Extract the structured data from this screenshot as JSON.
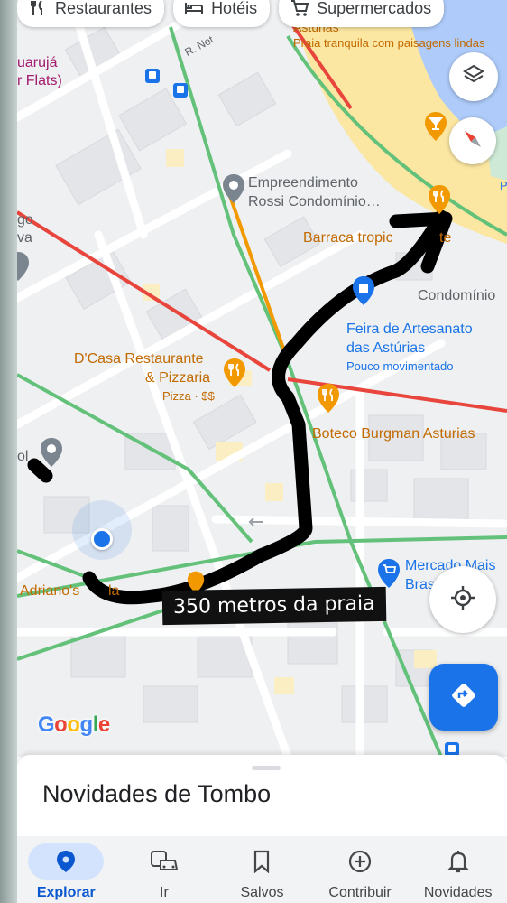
{
  "chips": [
    {
      "label": "Restaurantes",
      "icon": "fork-knife-icon"
    },
    {
      "label": "Hotéis",
      "icon": "bed-icon"
    },
    {
      "label": "Supermercados",
      "icon": "cart-icon"
    }
  ],
  "map": {
    "labels": {
      "road_r_net": "R. Net",
      "guaruja_1": "uarujá",
      "guaruja_2": "r Flats)",
      "asturias_cut": "Astúrias",
      "praia_tranquila": "Praia tranquila com paisagens lindas",
      "empreendimento_1": "Empreendimento",
      "empreendimento_2": "Rossi Condomínio…",
      "go_1": "go",
      "go_2": "va",
      "barraca": "Barraca tropic",
      "barraca_tail": "te",
      "condominio": "Condomínio",
      "feira_1": "Feira de Artesanato",
      "feira_2": "das Astúrias",
      "feira_status": "Pouco movimentado",
      "dcasa_1": "D'Casa Restaurante",
      "dcasa_2": "& Pizzaria",
      "dcasa_sub": "Pizza · $$",
      "boteco": "Boteco Burgman Asturias",
      "ol": "ol",
      "mercado_1": "Mercado Mais",
      "mercado_2": "Bras",
      "adriano": "Adriano's",
      "adriano_tail": "la",
      "p_cut": "P"
    },
    "annotation": "350 metros da praia",
    "google_letters": [
      "G",
      "o",
      "o",
      "g",
      "l",
      "e"
    ],
    "google_colors": [
      "#4285F4",
      "#EA4335",
      "#FBBC05",
      "#4285F4",
      "#34A853",
      "#EA4335"
    ]
  },
  "sheet": {
    "title": "Novidades de Tombo"
  },
  "nav": [
    {
      "label": "Explorar",
      "active": true
    },
    {
      "label": "Ir",
      "active": false
    },
    {
      "label": "Salvos",
      "active": false
    },
    {
      "label": "Contribuir",
      "active": false
    },
    {
      "label": "Novidades",
      "active": false
    }
  ],
  "colors": {
    "accent": "#1a73e8",
    "poi_orange": "#f29900",
    "beach": "#fbe6a2",
    "water": "#aecbfa",
    "park": "#ceead6",
    "traffic_green": "#63c17a",
    "traffic_red": "#e8453c"
  }
}
